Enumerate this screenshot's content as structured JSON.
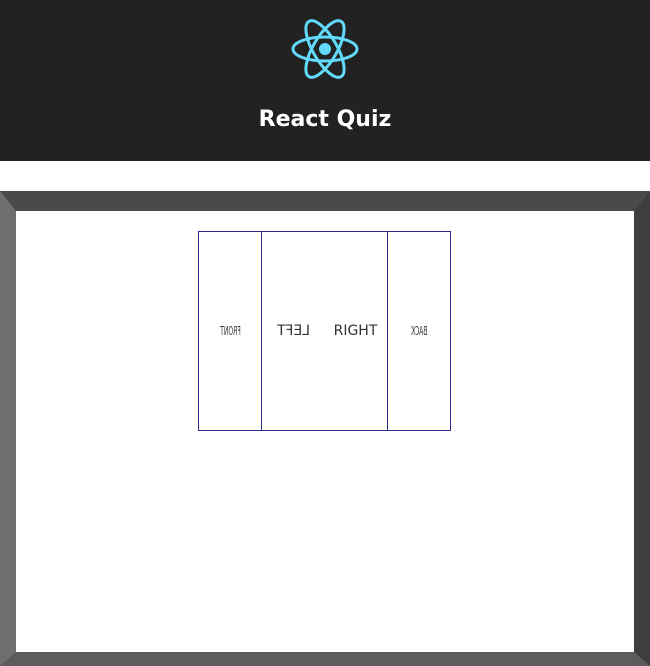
{
  "header": {
    "title": "React Quiz",
    "logo_icon": "react-atom-logo",
    "background_color": "#222222",
    "logo_color": "#61dafb"
  },
  "cube": {
    "faces": [
      {
        "name": "front",
        "label": "FRONT"
      },
      {
        "name": "left",
        "label": "LEFT"
      },
      {
        "name": "right",
        "label": "RIGHT"
      },
      {
        "name": "back",
        "label": "BACK"
      }
    ],
    "border_color": "#2b2b8c"
  },
  "stage": {
    "frame_color": "#555555"
  }
}
